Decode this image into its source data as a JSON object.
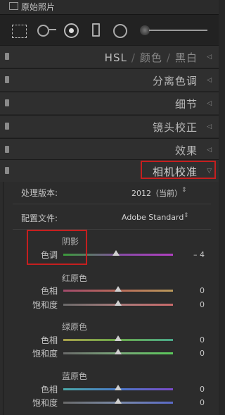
{
  "top": {
    "original_label": "原始照片"
  },
  "panels": {
    "hsl": {
      "seg1": "HSL",
      "sep": "/",
      "seg2": "颜色",
      "seg3": "黑白"
    },
    "split": "分离色调",
    "detail": "细节",
    "lens": "镜头校正",
    "effects": "效果",
    "calibration": "相机校准"
  },
  "calibration": {
    "process_label": "处理版本:",
    "process_value": "2012（当前）",
    "profile_label": "配置文件:",
    "profile_value": "Adobe Standard",
    "select_arrow": "⌃⌄",
    "shadows": {
      "title": "阴影",
      "tint_label": "色调",
      "tint_value": "– 4",
      "tint": -4
    },
    "red": {
      "title": "红原色",
      "hue_label": "色相",
      "hue_value": "0",
      "sat_label": "饱和度",
      "sat_value": "0"
    },
    "green": {
      "title": "绿原色",
      "hue_label": "色相",
      "hue_value": "0",
      "sat_label": "饱和度",
      "sat_value": "0"
    },
    "blue": {
      "title": "蓝原色",
      "hue_label": "色相",
      "hue_value": "0",
      "sat_label": "饱和度",
      "sat_value": "0"
    }
  },
  "colors": {
    "highlight_box": "#c51f1f"
  }
}
